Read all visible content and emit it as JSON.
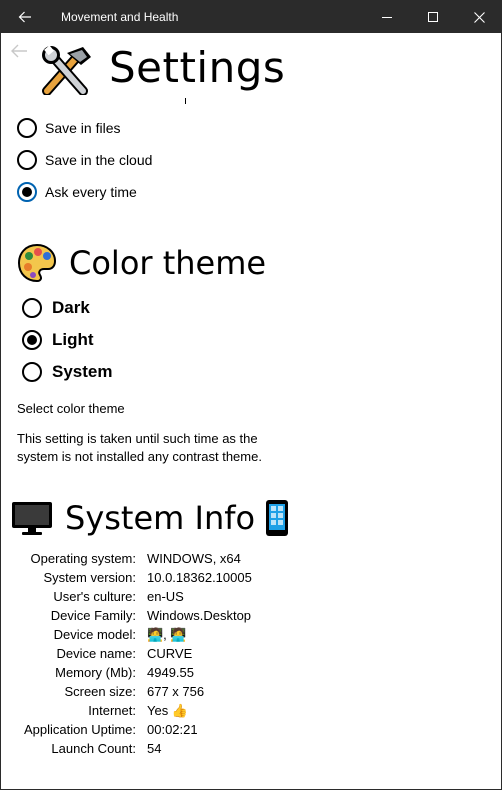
{
  "window": {
    "title": "Movement and Health"
  },
  "header": {
    "title": "Settings"
  },
  "save_options": [
    {
      "label": "Save in files",
      "selected": false
    },
    {
      "label": "Save in the cloud",
      "selected": false
    },
    {
      "label": "Ask every time",
      "selected": true
    }
  ],
  "color_theme": {
    "title": "Color theme",
    "options": [
      {
        "label": "Dark",
        "selected": false
      },
      {
        "label": "Light",
        "selected": true
      },
      {
        "label": "System",
        "selected": false
      }
    ],
    "caption": "Select color theme",
    "note_line1": "This setting is taken until such time as the",
    "note_line2": "system is not installed any contrast theme."
  },
  "system_info": {
    "title": "System Info",
    "rows": [
      {
        "key": "Operating system:",
        "value": "WINDOWS, x64"
      },
      {
        "key": "System version:",
        "value": "10.0.18362.10005"
      },
      {
        "key": "User's culture:",
        "value": "en-US"
      },
      {
        "key": "Device Family:",
        "value": "Windows.Desktop"
      },
      {
        "key": "Device model:",
        "value": "🧑‍💻, 🧑‍💻"
      },
      {
        "key": "Device name:",
        "value": "CURVE"
      },
      {
        "key": "Memory (Mb):",
        "value": "4949.55"
      },
      {
        "key": "Screen size:",
        "value": "677 x 756"
      },
      {
        "key": "Internet:",
        "value": "Yes 👍"
      },
      {
        "key": "Application Uptime:",
        "value": "00:02:21"
      },
      {
        "key": "Launch Count:",
        "value": "54"
      }
    ]
  },
  "colors": {
    "titlebar": "#2b2b2b",
    "accent": "#0063b1",
    "background": "#ffffff"
  },
  "icons": [
    "back-arrow-icon",
    "minimize-icon",
    "maximize-icon",
    "close-icon",
    "tools-icon",
    "palette-icon",
    "monitor-icon",
    "phone-icon",
    "thumbs-up-icon"
  ]
}
